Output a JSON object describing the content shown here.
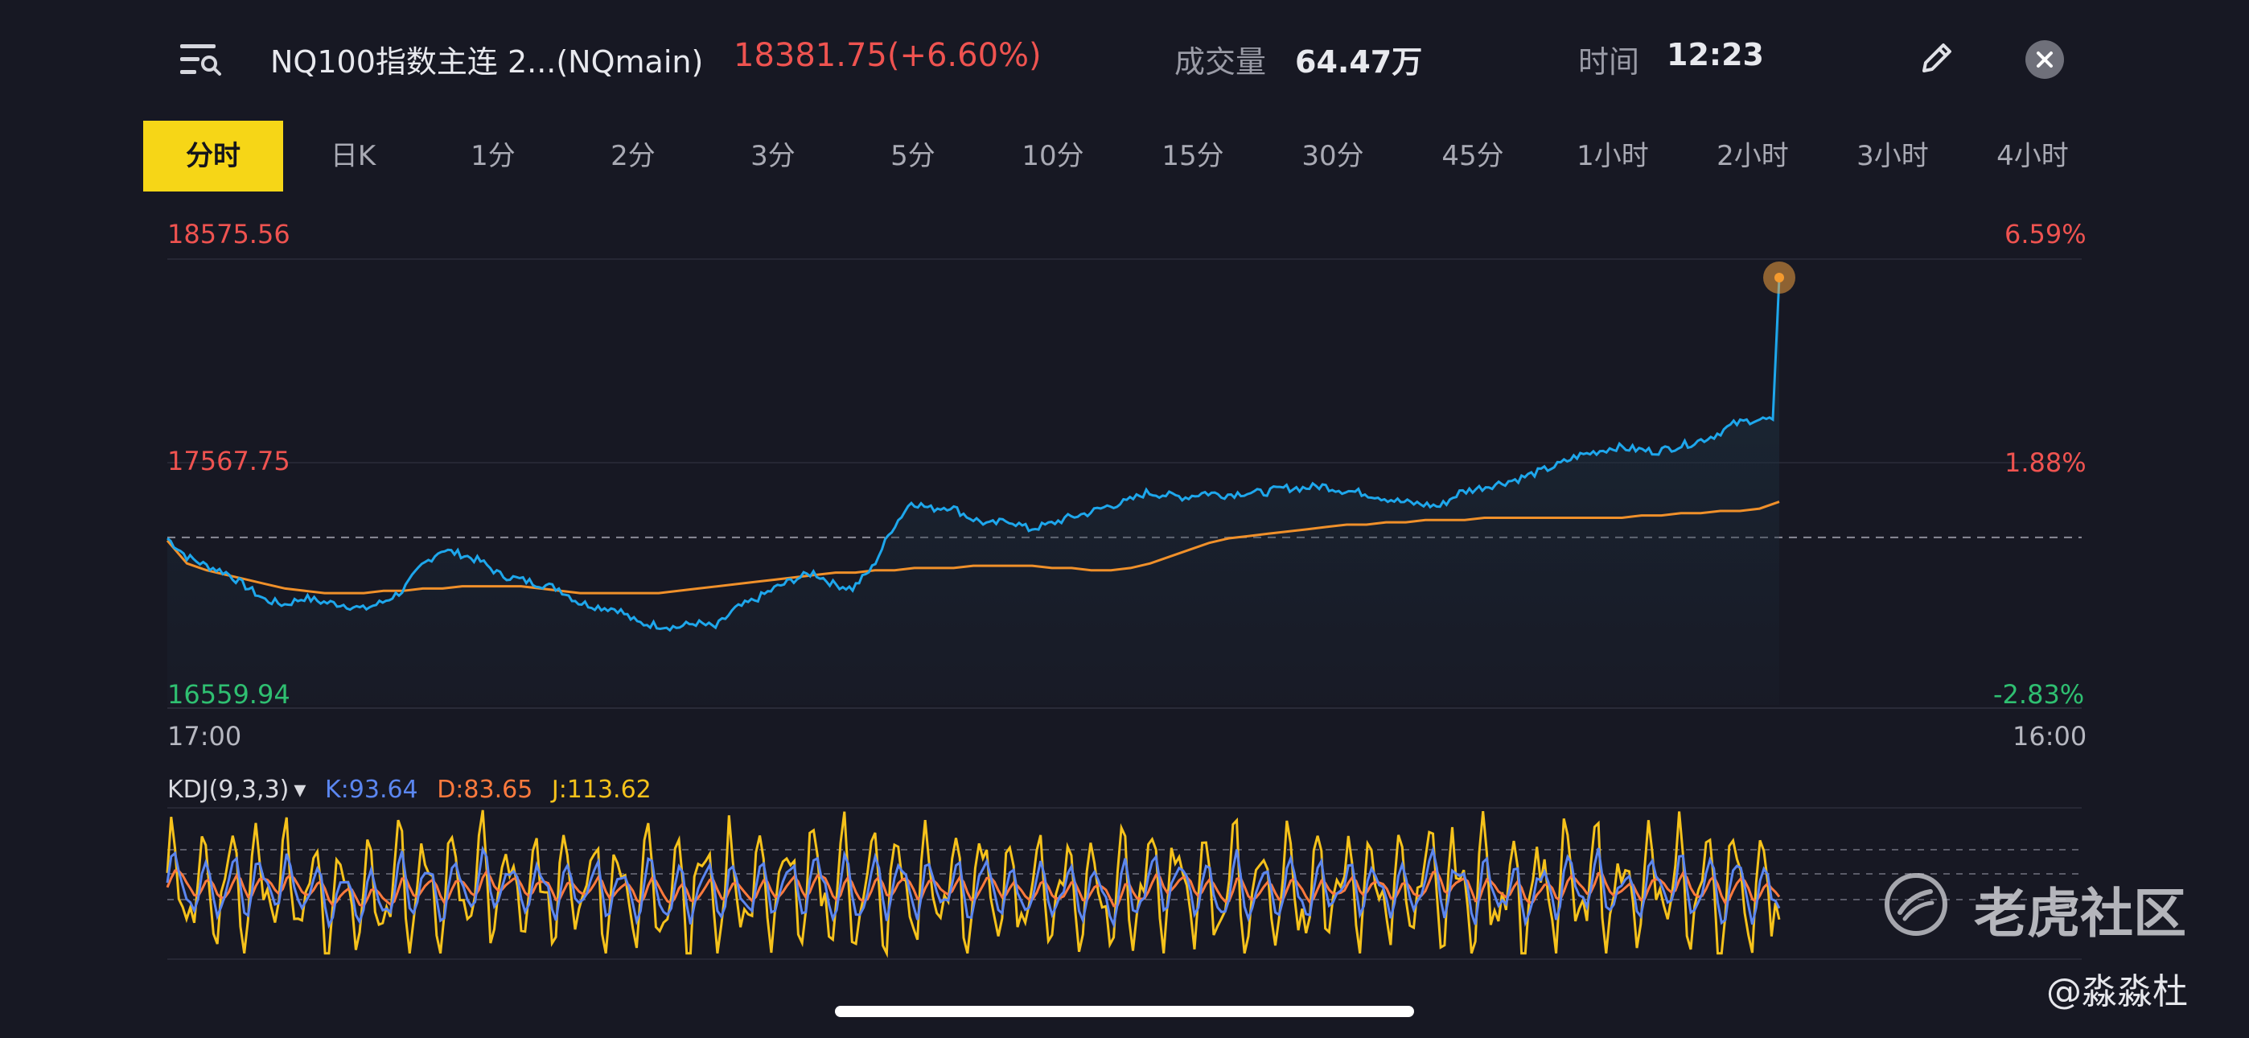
{
  "header": {
    "title": "NQ100指数主连 2...(NQmain)",
    "price": "18381.75(+6.60%)",
    "volume_label": "成交量",
    "volume_value": "64.47万",
    "time_label": "时间",
    "time_value": "12:23",
    "icons": {
      "menu": "list-search-icon",
      "edit": "pencil-icon",
      "close": "close-icon"
    }
  },
  "tabs": [
    {
      "label": "分时",
      "active": true
    },
    {
      "label": "日K",
      "active": false
    },
    {
      "label": "1分",
      "active": false
    },
    {
      "label": "2分",
      "active": false
    },
    {
      "label": "3分",
      "active": false
    },
    {
      "label": "5分",
      "active": false
    },
    {
      "label": "10分",
      "active": false
    },
    {
      "label": "15分",
      "active": false
    },
    {
      "label": "30分",
      "active": false
    },
    {
      "label": "45分",
      "active": false
    },
    {
      "label": "1小时",
      "active": false
    },
    {
      "label": "2小时",
      "active": false
    },
    {
      "label": "3小时",
      "active": false
    },
    {
      "label": "4小时",
      "active": false
    }
  ],
  "axis": {
    "y_high": "18575.56",
    "y_mid": "17567.75",
    "y_low": "16559.94",
    "pct_high": "6.59%",
    "pct_mid": "1.88%",
    "pct_low": "-2.83%",
    "x_start": "17:00",
    "x_end": "16:00"
  },
  "kdj": {
    "name": "KDJ(9,3,3)",
    "k": "K:93.64",
    "d": "D:83.65",
    "j": "J:113.62"
  },
  "watermark": {
    "brand": "老虎社区",
    "user": "@淼淼杜"
  },
  "colors": {
    "background": "#171823",
    "price_line": "#1ea7ec",
    "avg_line": "#f0902a",
    "up": "#ef5350",
    "down": "#2fbf71",
    "tab_active": "#f6d617",
    "k_line": "#5b86f0",
    "d_line": "#ff7a3d",
    "j_line": "#f6c21b"
  },
  "chart_data": {
    "type": "line",
    "ylim": [
      16559.94,
      18575.56
    ],
    "baseline": 17244.0,
    "x_range": [
      "17:00",
      "16:00"
    ],
    "series": [
      {
        "values": [
          17240,
          17160,
          17120,
          17090,
          17030,
          16970,
          16950,
          16980,
          16960,
          16950,
          16930,
          16960,
          17010,
          17120,
          17190,
          17170,
          17140,
          17080,
          17060,
          17040,
          17020,
          16960,
          16940,
          16930,
          16870,
          16860,
          16850,
          16870,
          16850,
          16930,
          16970,
          17020,
          17060,
          17090,
          17040,
          17020,
          17110,
          17280,
          17400,
          17370,
          17380,
          17330,
          17300,
          17320,
          17280,
          17300,
          17330,
          17350,
          17380,
          17400,
          17440,
          17430,
          17420,
          17440,
          17430,
          17440,
          17440,
          17460,
          17460,
          17470,
          17450,
          17440,
          17420,
          17400,
          17390,
          17380,
          17440,
          17460,
          17480,
          17500,
          17530,
          17560,
          17600,
          17620,
          17640,
          17630,
          17620,
          17640,
          17660,
          17690,
          17740,
          17760,
          17760
        ]
      },
      {
        "values": [
          17230,
          17130,
          17100,
          17080,
          17060,
          17040,
          17020,
          17010,
          17000,
          17000,
          17000,
          17010,
          17010,
          17020,
          17020,
          17030,
          17030,
          17030,
          17030,
          17020,
          17010,
          17000,
          17000,
          17000,
          17000,
          17000,
          17010,
          17020,
          17030,
          17040,
          17050,
          17060,
          17070,
          17080,
          17090,
          17090,
          17100,
          17100,
          17110,
          17110,
          17110,
          17120,
          17120,
          17120,
          17120,
          17110,
          17110,
          17100,
          17100,
          17110,
          17130,
          17160,
          17190,
          17220,
          17240,
          17250,
          17260,
          17270,
          17280,
          17290,
          17300,
          17300,
          17310,
          17310,
          17320,
          17320,
          17320,
          17330,
          17330,
          17330,
          17330,
          17330,
          17330,
          17330,
          17330,
          17340,
          17340,
          17350,
          17350,
          17360,
          17360,
          17370,
          17400
        ]
      }
    ],
    "last_value": 18381.75
  }
}
